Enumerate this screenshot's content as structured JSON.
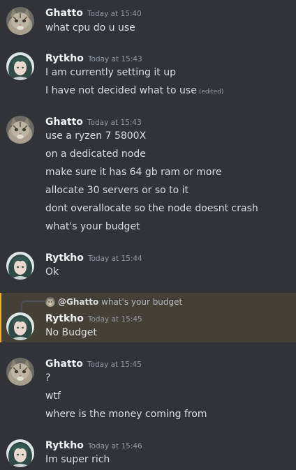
{
  "messages": [
    {
      "author": "Ghatto",
      "time": "Today at 15:40",
      "avatar": "cat-avatar",
      "lines": [
        "what cpu do u use"
      ]
    },
    {
      "author": "Rytkho",
      "time": "Today at 15:43",
      "avatar": "anime-avatar",
      "lines": [
        "I am currently setting it up",
        "I have not decided what to use"
      ],
      "edited_label": "(edited)"
    },
    {
      "author": "Ghatto",
      "time": "Today at 15:43",
      "avatar": "cat-avatar",
      "lines": [
        "use a ryzen 7 5800X",
        "on a dedicated node",
        "make sure it has 64 gb ram or more",
        "allocate 30 servers or so to it",
        "dont overallocate so the node doesnt crash",
        "what's your budget"
      ]
    },
    {
      "author": "Rytkho",
      "time": "Today at 15:44",
      "avatar": "anime-avatar",
      "lines": [
        "Ok"
      ]
    },
    {
      "author": "Rytkho",
      "time": "Today at 15:45",
      "avatar": "anime-avatar",
      "reply_mention": "@Ghatto",
      "reply_text": "what's your budget",
      "highlighted": true,
      "lines": [
        "No Budget"
      ]
    },
    {
      "author": "Ghatto",
      "time": "Today at 15:45",
      "avatar": "cat-avatar",
      "lines": [
        "?",
        "wtf",
        "where is the money coming from"
      ]
    },
    {
      "author": "Rytkho",
      "time": "Today at 15:46",
      "avatar": "anime-avatar",
      "lines": [
        "Im super rich"
      ]
    }
  ],
  "colors": {
    "background": "#313338",
    "highlight": "#444036",
    "highlight_bar": "#f0b232",
    "username": "#f2f3f5",
    "timestamp": "#949ba4"
  }
}
